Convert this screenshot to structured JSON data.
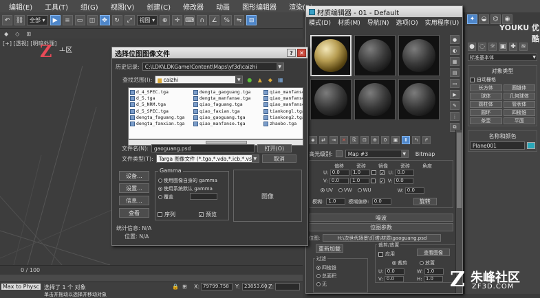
{
  "menubar": {
    "items": [
      "编辑(E)",
      "工具(T)",
      "组(G)",
      "视图(V)",
      "创建(C)",
      "修改器",
      "动画",
      "图形编辑器",
      "渲染(R)"
    ]
  },
  "toolbar": {
    "selection_filter": "全部",
    "ref_coord": "视图"
  },
  "viewport": {
    "label": "[+] [透视] [明暗处理]",
    "gizmo_label": "ㅗ区"
  },
  "file_dialog": {
    "title": "选择位图图像文件",
    "history_label": "历史记录:",
    "history_value": "C:\\LDK\\LDKGame\\Content\\Maps\\yf3d\\caizhi",
    "lookin_label": "查找范围(I):",
    "lookin_value": "caizhi",
    "files": [
      [
        "d_4_SPEC.tga",
        "d_5.tga",
        "d_5_NRM.tga",
        "d_5_SPEC.tga",
        "dengta_faguang.tga",
        "dengta_fanxian.tga"
      ],
      [
        "dengta_gaoguang.tga",
        "dengta_manfanse.tga",
        "qiao_faguang.tga",
        "qiao_faxian.tga",
        "qiao_gaoguang.tga",
        "qiao_manfanse.tga"
      ],
      [
        "qiao_manfanse",
        "qiao_manfanse",
        "qiao_manfanse",
        "tiankongl.tga",
        "tiankong2.tga",
        "zhaobo.tga"
      ]
    ],
    "filename_label": "文件名(N):",
    "filename_value": "gaoguang.psd",
    "filetype_label": "文件类型(T):",
    "filetype_value": "Targa 图像文件 (*.tga,*.vda,*.icb,*.vst)",
    "open_button": "打开(O)",
    "cancel_button": "取消",
    "setup_button": "设备...",
    "settings_button": "设置...",
    "info_button": "信息...",
    "view_button": "查看",
    "gamma_title": "Gamma",
    "gamma_opt_own": "使用图像自身的 gamma",
    "gamma_opt_system": "使用系统默认 gamma",
    "gamma_opt_override": "覆盖",
    "sequence_label": "序列",
    "preview_label": "预览",
    "stats_label": "统计信息: N/A",
    "location_label": "位置: N/A",
    "preview_text": "图像"
  },
  "material_editor": {
    "title": "材质编辑器 - 01 - Default",
    "menu": [
      "模式(D)",
      "材质(M)",
      "导航(N)",
      "选项(O)",
      "实用程序(U)"
    ],
    "highlight_label": "高光级别:",
    "map_name": "Map #3",
    "map_type": "Bitmap",
    "coords_headers": [
      "偏移",
      "瓷砖",
      "镜像",
      "瓷砖",
      "角度"
    ],
    "u_label": "U:",
    "v_label": "V:",
    "w_label": "W:",
    "u_offset": "0.0",
    "u_tile": "1.0",
    "u_angle": "0.0",
    "v_offset": "0.0",
    "v_tile": "1.0",
    "v_angle": "0.0",
    "w_angle": "0.0",
    "uv_opts": [
      "UV",
      "VW",
      "WU"
    ],
    "blur_label": "模糊:",
    "blur_value": "1.0",
    "blur_offset_label": "模糊偏移:",
    "blur_offset_value": "0.0",
    "rotate_button": "旋转",
    "rollout_noise": "噪波",
    "rollout_bitmap": "位图参数",
    "bitmap_label": "位图:",
    "bitmap_path": "H:\\次世代场景\\灯塔\\材质\\gaoguang.psd",
    "reload_button": "重新加载",
    "crop_title": "裁剪/放置",
    "apply_label": "应用",
    "view_image_button": "查看图像",
    "crop_label": "裁剪",
    "place_label": "放置",
    "filter_title": "过滤",
    "filter_opts": [
      "四棱锥",
      "总面积",
      "无"
    ],
    "u_crop": "0.0",
    "w_crop": "1.0",
    "v_crop": "0.0",
    "h_crop": "1.0"
  },
  "command_panel": {
    "category": "标准基本体",
    "group_title": "对象类型",
    "autogrid": "自动栅格",
    "objects": [
      "长方体",
      "圆锥体",
      "球体",
      "几何球体",
      "圆柱体",
      "管状体",
      "圆环",
      "四棱锥",
      "茶壶",
      "平面"
    ],
    "name_title": "名称和颜色",
    "object_name": "Plane001"
  },
  "status": {
    "frame": "0 / 100",
    "selection": "选择了 1 个 对象",
    "hint": "单击并拖动以选择并移动对象",
    "maxscript": "Max to Physc",
    "x_label": "X:",
    "x_value": "79799.758",
    "y_label": "Y:",
    "y_value": "23853.60",
    "z_label": "Z:"
  },
  "branding": {
    "youku": "YOUKU 优酷",
    "site_name": "朱峰社区",
    "site_url": "ZF3D.COM"
  }
}
